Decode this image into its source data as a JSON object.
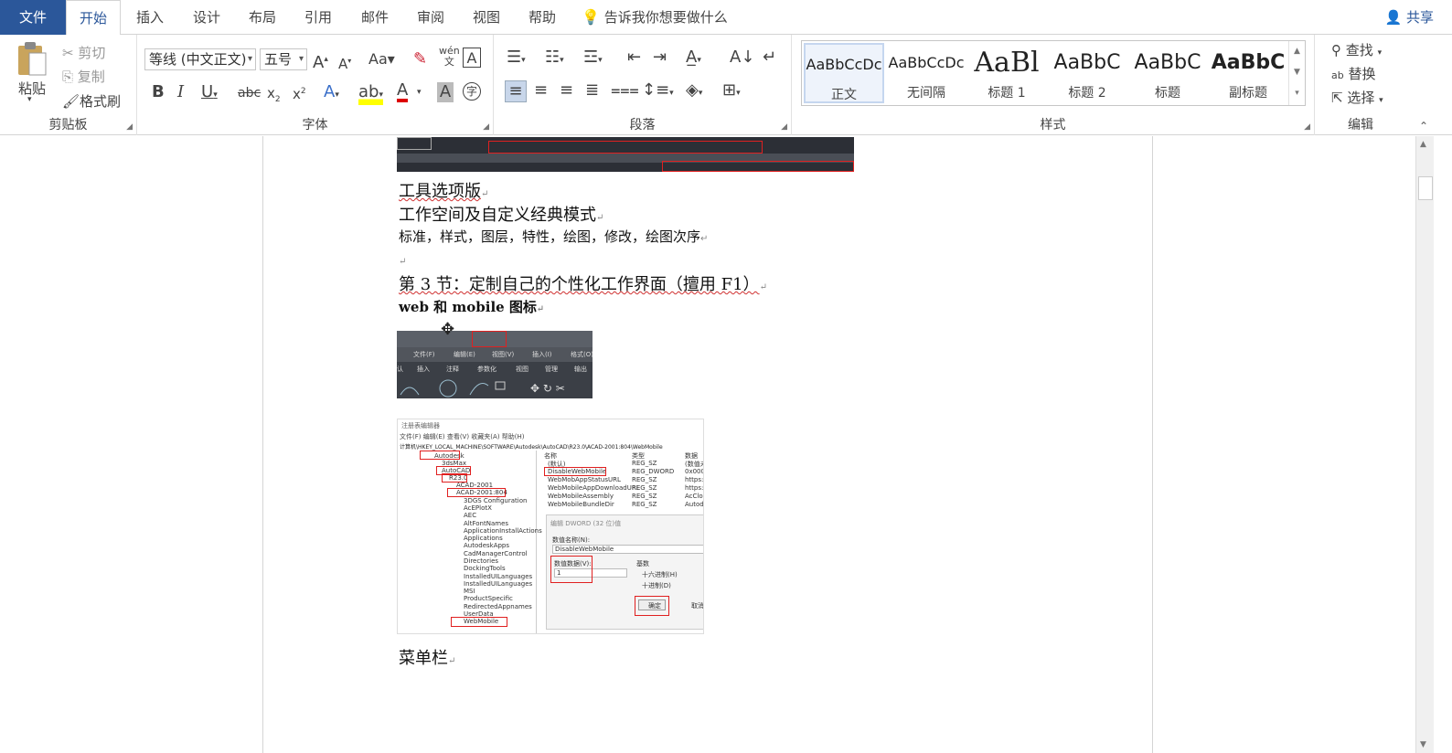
{
  "tabs": {
    "file": "文件",
    "items": [
      "开始",
      "插入",
      "设计",
      "布局",
      "引用",
      "邮件",
      "审阅",
      "视图",
      "帮助"
    ],
    "tell_me": "告诉我你想要做什么",
    "share": "共享"
  },
  "clipboard": {
    "paste": "粘贴",
    "cut": "剪切",
    "copy": "复制",
    "format_painter": "格式刷",
    "label": "剪贴板"
  },
  "font": {
    "name": "等线 (中文正文)",
    "size": "五号",
    "label": "字体"
  },
  "paragraph": {
    "label": "段落"
  },
  "styles": {
    "label": "样式",
    "items": [
      {
        "preview": "AaBbCcDc",
        "name": "正文"
      },
      {
        "preview": "AaBbCcDc",
        "name": "无间隔"
      },
      {
        "preview": "AaBl",
        "name": "标题 1"
      },
      {
        "preview": "AaBbC",
        "name": "标题 2"
      },
      {
        "preview": "AaBbC",
        "name": "标题"
      },
      {
        "preview": "AaBbC",
        "name": "副标题"
      }
    ]
  },
  "editing": {
    "find": "查找",
    "replace": "替换",
    "select": "选择",
    "label": "编辑"
  },
  "document": {
    "lines": [
      "工具选项版",
      "工作空间及自定义经典模式",
      "标准，样式，图层，特性，绘图，修改，绘图次序",
      "第 3 节：定制自己的个性化工作界面（擅用 F1）",
      "web 和 mobile 图标",
      "菜单栏"
    ],
    "embedded_toolbar": {
      "menu": [
        "文件(F)",
        "编辑(E)",
        "视图(V)",
        "插入(I)",
        "格式(O)"
      ],
      "ribbon_tabs": [
        "认",
        "插入",
        "注释",
        "参数化",
        "视图",
        "管理",
        "输出"
      ]
    },
    "embedded_registry": {
      "title": "注册表编辑器",
      "menu": "文件(F)  编辑(E)  查看(V)  收藏夹(A)  帮助(H)",
      "path": "计算机\\HKEY_LOCAL_MACHINE\\SOFTWARE\\Autodesk\\AutoCAD\\R23.0\\ACAD-2001:804\\WebMobile",
      "tree": [
        "Autodesk",
        "3dsMax",
        "AutoCAD",
        "R23.0",
        "ACAD-2001",
        "ACAD-2001:804",
        "3DGS Configuration",
        "AcEPlotX",
        "AEC",
        "AltFontNames",
        "ApplicationInstallActions",
        "Applications",
        "AutodeskApps",
        "CadManagerControl",
        "Directories",
        "DockingTools",
        "InstalledUILanguages",
        "InstalledUILanguages",
        "MSI",
        "ProductSpecific",
        "RedirectedAppnames",
        "UserData",
        "WebMobile"
      ],
      "columns": [
        "名称",
        "类型",
        "数据"
      ],
      "rows": [
        [
          "(默认)",
          "REG_SZ",
          "(数值未设"
        ],
        [
          "DisableWebMobile",
          "REG_DWORD",
          "0x0000C"
        ],
        [
          "WebMobAppStatusURL",
          "REG_SZ",
          "https://"
        ],
        [
          "WebMobileAppDownloadURL",
          "REG_SZ",
          "https://"
        ],
        [
          "WebMobileAssembly",
          "REG_SZ",
          "AcCloud"
        ],
        [
          "WebMobileBundleDir",
          "REG_SZ",
          "Autodes"
        ]
      ],
      "dialog": {
        "title": "编辑 DWORD (32 位)值",
        "name_label": "数值名称(N):",
        "name_value": "DisableWebMobile",
        "data_label": "数值数据(V):",
        "data_value": "1",
        "base_label": "基数",
        "hex": "十六进制(H)",
        "dec": "十进制(D)",
        "ok": "确定",
        "cancel": "取消"
      }
    }
  }
}
